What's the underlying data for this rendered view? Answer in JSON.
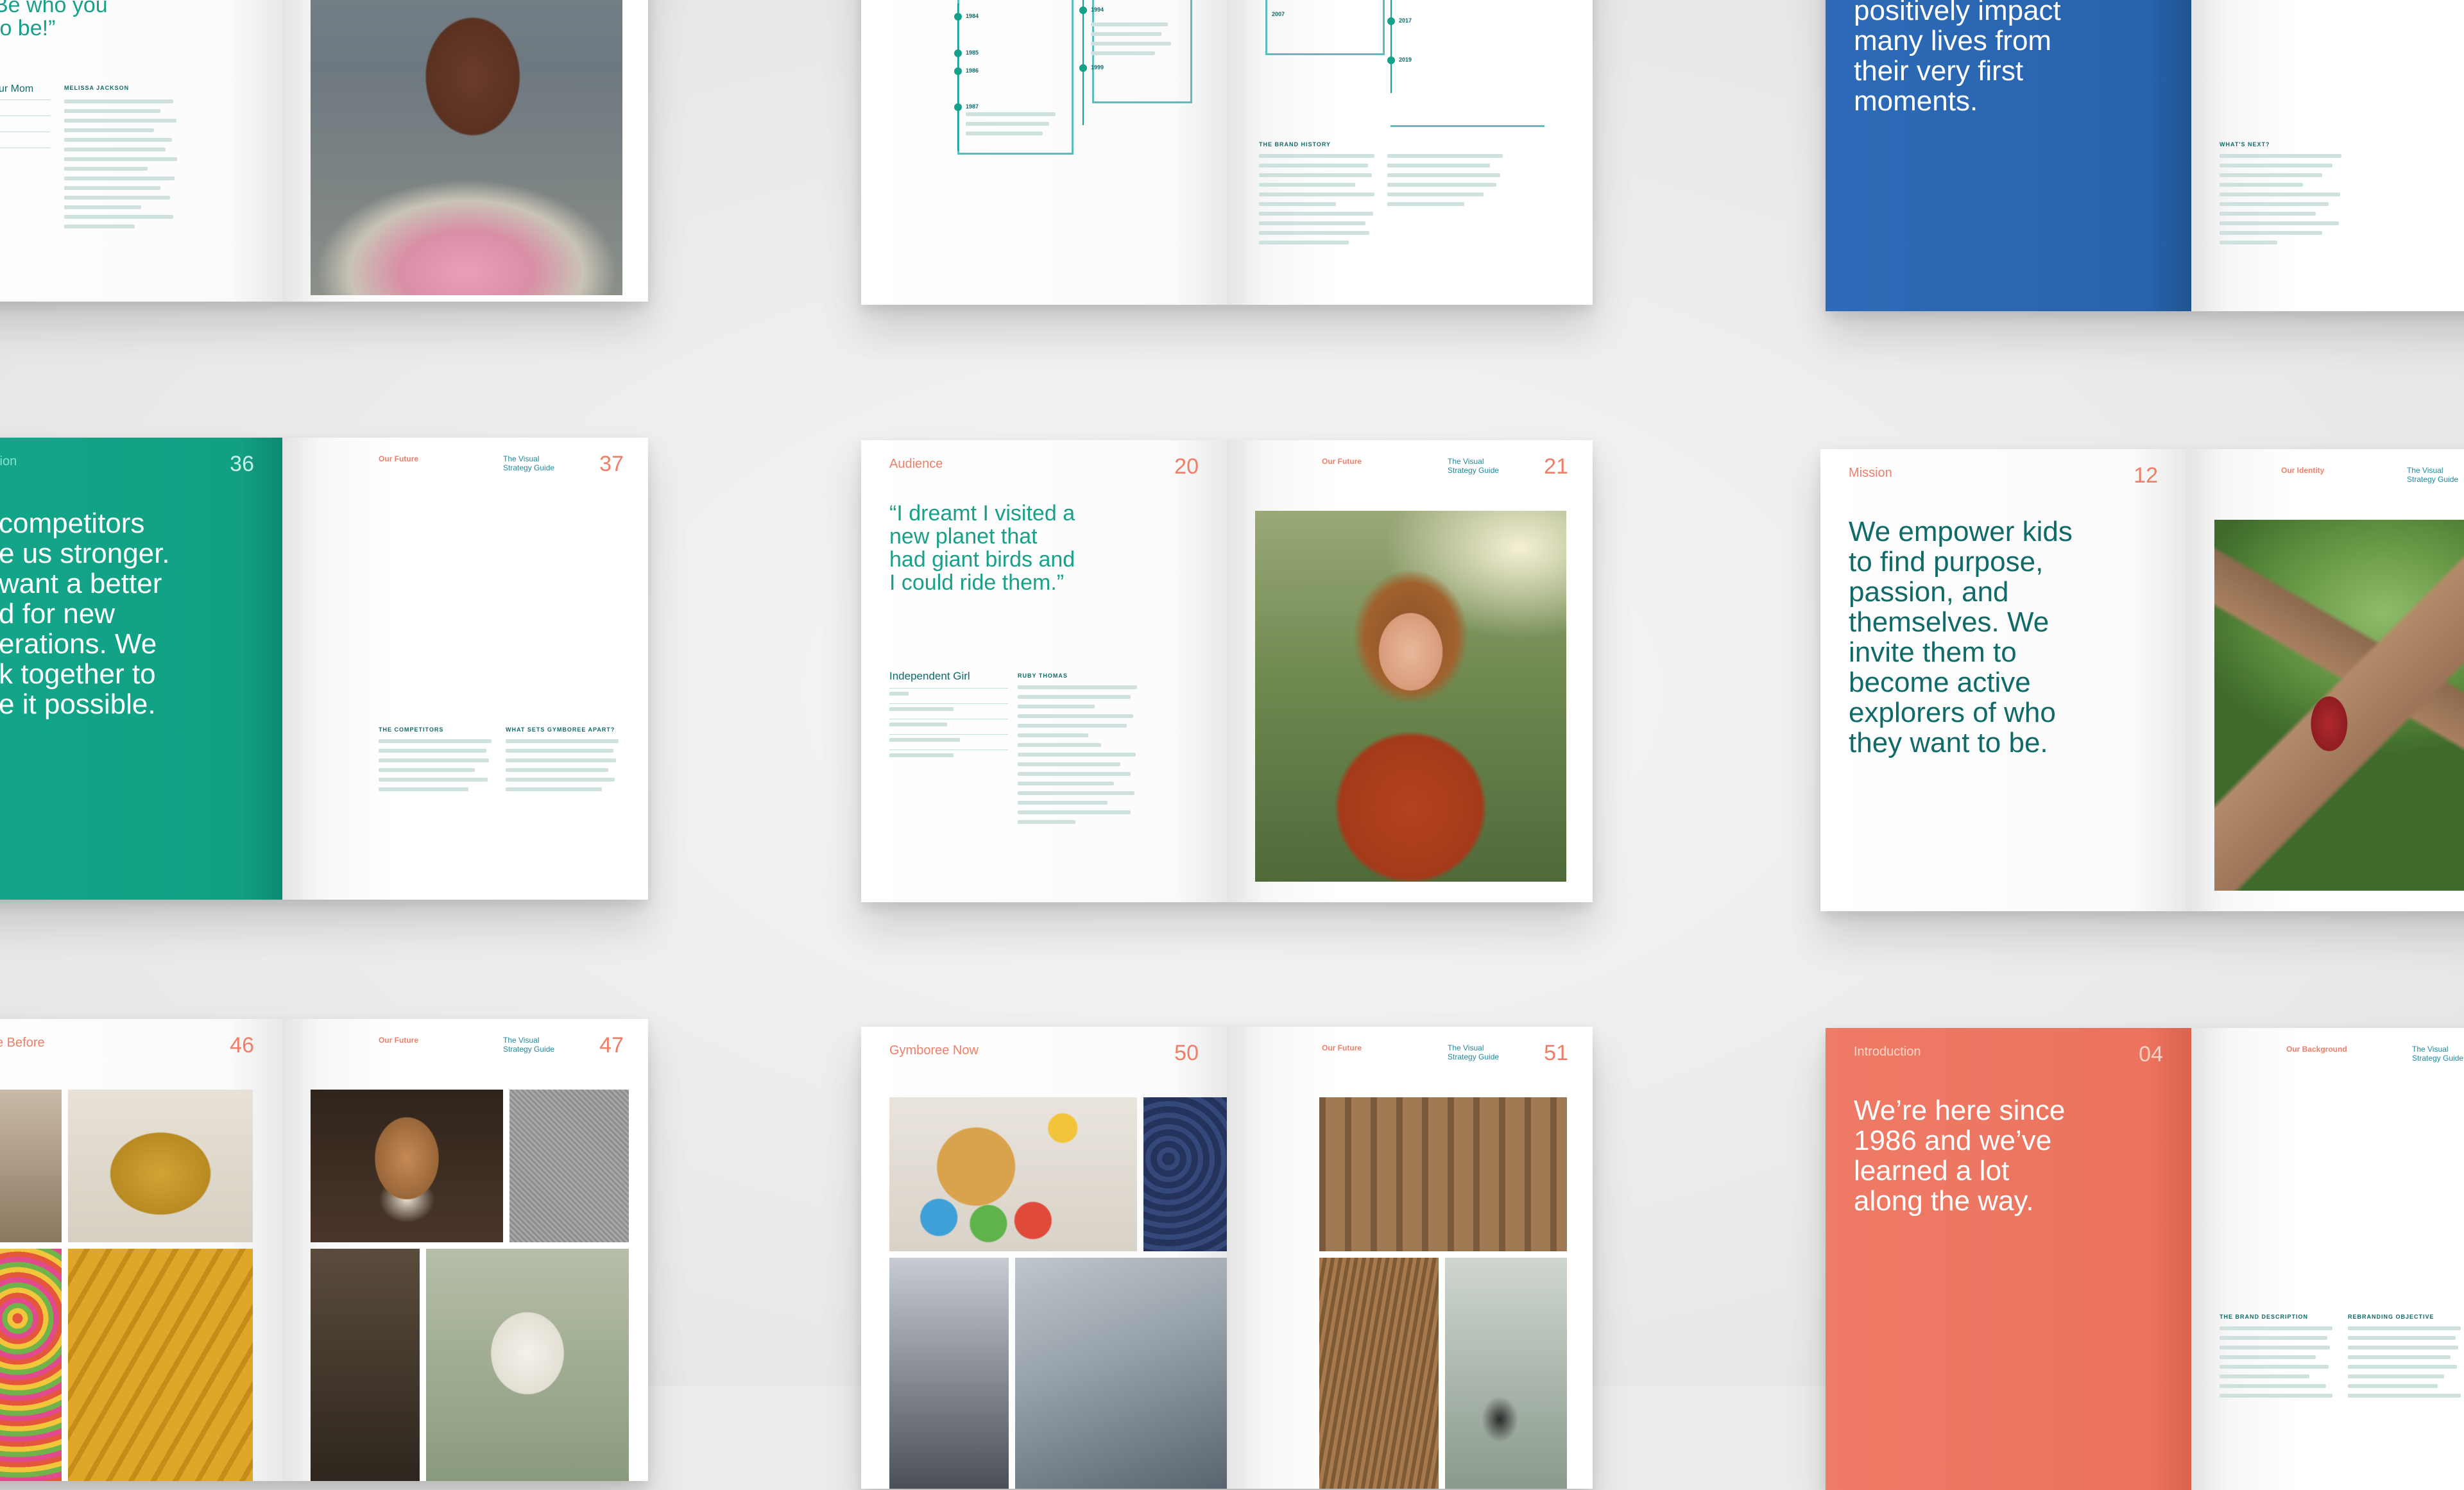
{
  "spreads": {
    "top_left": {
      "quote_fragment_line1": "Be who you",
      "quote_fragment_line2": "to be!”",
      "persona_fragment": "ur Mom",
      "author": "MELISSA JACKSON"
    },
    "top_center": {
      "years_left": [
        "1984",
        "1985",
        "1986",
        "1987"
      ],
      "years_mid": [
        "1994",
        "1999"
      ],
      "years_right": [
        "2007",
        "2017",
        "2019"
      ],
      "history_head": "THE BRAND HISTORY"
    },
    "top_right": {
      "text_line1": "positively impact",
      "text_line2": "many lives from",
      "text_line3": "their very first",
      "text_line4": "moments.",
      "next_head": "WHAT'S NEXT?"
    },
    "middle_left": {
      "section_fragment": "tion",
      "left_num": "36",
      "right_head": "Our Future",
      "guide": "The Visual Strategy Guide",
      "right_num": "37",
      "text_lines": [
        "competitors",
        "e us stronger.",
        "want a better",
        "d for new",
        "erations. We",
        "k together to",
        "e it possible."
      ],
      "head_competitors": "THE COMPETITORS",
      "head_apart": "WHAT SETS GYMBOREE APART?"
    },
    "middle_center": {
      "section": "Audience",
      "left_num": "20",
      "right_head": "Our Future",
      "guide": "The Visual Strategy Guide",
      "right_num": "21",
      "quote": "“I dreamt I visited a new planet that had giant birds and I could ride them.”",
      "persona_title": "Independent Girl",
      "persona_author": "RUBY THOMAS"
    },
    "middle_right": {
      "section": "Mission",
      "left_num": "12",
      "right_head": "Our Identity",
      "guide": "The Visual Strategy Guide",
      "statement": "We empower kids to find purpose, passion, and themselves. We invite them to become active explorers of who they want to be."
    },
    "bottom_left": {
      "section_fragment": "e Before",
      "left_num": "46",
      "right_head": "Our Future",
      "guide": "The Visual Strategy Guide",
      "right_num": "47"
    },
    "bottom_center": {
      "section": "Gymboree Now",
      "left_num": "50",
      "right_head": "Our Future",
      "guide": "The Visual Strategy Guide",
      "right_num": "51"
    },
    "bottom_right": {
      "section": "Introduction",
      "left_num": "04",
      "right_head": "Our Background",
      "guide": "The Visual Strategy Guide",
      "statement": "We’re here since 1986 and we’ve learned a lot along the way.",
      "head_desc": "THE BRAND DESCRIPTION",
      "head_objective": "REBRANDING OBJECTIVE"
    }
  }
}
